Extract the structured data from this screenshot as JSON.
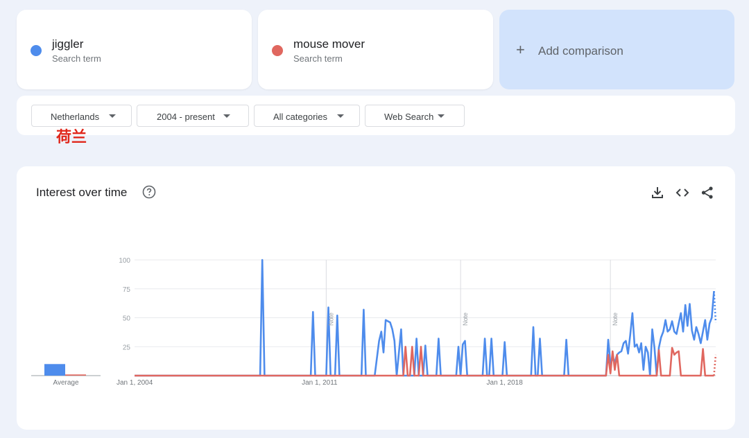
{
  "terms": [
    {
      "name": "jiggler",
      "subtitle": "Search term",
      "color": "#4e8cec"
    },
    {
      "name": "mouse mover",
      "subtitle": "Search term",
      "color": "#e0675f"
    }
  ],
  "add_comparison": {
    "icon": "plus-icon",
    "label": "Add comparison"
  },
  "filters": [
    {
      "label": "Netherlands"
    },
    {
      "label": "2004 - present"
    },
    {
      "label": "All categories"
    },
    {
      "label": "Web Search"
    }
  ],
  "annotation": "荷兰",
  "chart": {
    "title": "Interest over time",
    "icons": [
      "help-icon",
      "download-icon",
      "embed-code-icon",
      "share-icon"
    ]
  },
  "chart_data": {
    "type": "line",
    "ylim": [
      0,
      100
    ],
    "yticks": [
      100,
      75,
      50,
      25
    ],
    "xticks": [
      "Jan 1, 2004",
      "Jan 1, 2011",
      "Jan 1, 2018"
    ],
    "notes": [
      {
        "label": "Note",
        "x": "2011-04"
      },
      {
        "label": "Note",
        "x": "2016-05"
      },
      {
        "label": "Note",
        "x": "2022-01"
      }
    ],
    "average": {
      "label": "Average",
      "values": [
        {
          "name": "jiggler",
          "value": 10
        },
        {
          "name": "mouse mover",
          "value": 1
        }
      ]
    },
    "series": [
      {
        "name": "jiggler",
        "color": "#4e8cec",
        "points": [
          [
            "2004-01",
            0
          ],
          [
            "2008-10",
            0
          ],
          [
            "2008-11",
            100
          ],
          [
            "2008-12",
            0
          ],
          [
            "2010-09",
            0
          ],
          [
            "2010-10",
            55
          ],
          [
            "2010-11",
            0
          ],
          [
            "2011-04",
            0
          ],
          [
            "2011-05",
            59
          ],
          [
            "2011-06",
            0
          ],
          [
            "2011-08",
            0
          ],
          [
            "2011-09",
            52
          ],
          [
            "2011-10",
            0
          ],
          [
            "2012-08",
            0
          ],
          [
            "2012-09",
            57
          ],
          [
            "2012-10",
            0
          ],
          [
            "2013-02",
            0
          ],
          [
            "2013-04",
            30
          ],
          [
            "2013-05",
            38
          ],
          [
            "2013-06",
            20
          ],
          [
            "2013-07",
            48
          ],
          [
            "2013-09",
            46
          ],
          [
            "2013-10",
            40
          ],
          [
            "2013-11",
            30
          ],
          [
            "2013-12",
            0
          ],
          [
            "2014-02",
            40
          ],
          [
            "2014-03",
            0
          ],
          [
            "2014-08",
            0
          ],
          [
            "2014-09",
            32
          ],
          [
            "2014-10",
            0
          ],
          [
            "2014-12",
            0
          ],
          [
            "2015-01",
            26
          ],
          [
            "2015-02",
            0
          ],
          [
            "2015-06",
            0
          ],
          [
            "2015-07",
            32
          ],
          [
            "2015-08",
            0
          ],
          [
            "2016-03",
            0
          ],
          [
            "2016-04",
            25
          ],
          [
            "2016-05",
            0
          ],
          [
            "2016-06",
            27
          ],
          [
            "2016-07",
            30
          ],
          [
            "2016-08",
            0
          ],
          [
            "2017-03",
            0
          ],
          [
            "2017-04",
            32
          ],
          [
            "2017-05",
            0
          ],
          [
            "2017-06",
            0
          ],
          [
            "2017-07",
            32
          ],
          [
            "2017-08",
            0
          ],
          [
            "2017-12",
            0
          ],
          [
            "2018-01",
            29
          ],
          [
            "2018-02",
            0
          ],
          [
            "2019-01",
            0
          ],
          [
            "2019-02",
            42
          ],
          [
            "2019-03",
            0
          ],
          [
            "2019-04",
            0
          ],
          [
            "2019-05",
            32
          ],
          [
            "2019-06",
            0
          ],
          [
            "2020-04",
            0
          ],
          [
            "2020-05",
            31
          ],
          [
            "2020-06",
            0
          ],
          [
            "2021-11",
            0
          ],
          [
            "2021-12",
            31
          ],
          [
            "2022-01",
            10
          ],
          [
            "2022-02",
            15
          ],
          [
            "2022-03",
            12
          ],
          [
            "2022-04",
            18
          ],
          [
            "2022-05",
            20
          ],
          [
            "2022-06",
            21
          ],
          [
            "2022-07",
            28
          ],
          [
            "2022-08",
            30
          ],
          [
            "2022-09",
            19
          ],
          [
            "2022-10",
            35
          ],
          [
            "2022-11",
            54
          ],
          [
            "2022-12",
            25
          ],
          [
            "2023-01",
            27
          ],
          [
            "2023-02",
            20
          ],
          [
            "2023-03",
            28
          ],
          [
            "2023-04",
            5
          ],
          [
            "2023-05",
            25
          ],
          [
            "2023-06",
            20
          ],
          [
            "2023-07",
            0
          ],
          [
            "2023-08",
            40
          ],
          [
            "2023-09",
            24
          ],
          [
            "2023-10",
            0
          ],
          [
            "2023-11",
            24
          ],
          [
            "2023-12",
            33
          ],
          [
            "2024-01",
            38
          ],
          [
            "2024-02",
            48
          ],
          [
            "2024-03",
            38
          ],
          [
            "2024-04",
            40
          ],
          [
            "2024-05",
            47
          ],
          [
            "2024-06",
            38
          ],
          [
            "2024-07",
            36
          ],
          [
            "2024-08",
            45
          ],
          [
            "2024-09",
            54
          ],
          [
            "2024-10",
            38
          ],
          [
            "2024-11",
            61
          ],
          [
            "2024-12",
            43
          ],
          [
            "2025-01",
            62
          ],
          [
            "2025-02",
            39
          ],
          [
            "2025-03",
            31
          ],
          [
            "2025-04",
            42
          ],
          [
            "2025-05",
            36
          ],
          [
            "2025-06",
            28
          ],
          [
            "2025-07",
            38
          ],
          [
            "2025-08",
            48
          ],
          [
            "2025-09",
            31
          ],
          [
            "2025-10",
            45
          ],
          [
            "2025-11",
            50
          ],
          [
            "2025-12",
            73
          ]
        ],
        "partial": [
          [
            "2025-12",
            73
          ],
          [
            "2026-01",
            46
          ]
        ]
      },
      {
        "name": "mouse mover",
        "color": "#e0675f",
        "points": [
          [
            "2004-01",
            0
          ],
          [
            "2014-03",
            0
          ],
          [
            "2014-04",
            25
          ],
          [
            "2014-05",
            0
          ],
          [
            "2014-06",
            0
          ],
          [
            "2014-07",
            25
          ],
          [
            "2014-08",
            0
          ],
          [
            "2014-10",
            0
          ],
          [
            "2014-11",
            25
          ],
          [
            "2014-12",
            0
          ],
          [
            "2021-11",
            0
          ],
          [
            "2021-12",
            18
          ],
          [
            "2022-01",
            2
          ],
          [
            "2022-02",
            21
          ],
          [
            "2022-03",
            5
          ],
          [
            "2022-04",
            18
          ],
          [
            "2022-05",
            0
          ],
          [
            "2023-10",
            0
          ],
          [
            "2023-11",
            22
          ],
          [
            "2023-12",
            0
          ],
          [
            "2024-04",
            0
          ],
          [
            "2024-05",
            24
          ],
          [
            "2024-06",
            18
          ],
          [
            "2024-07",
            20
          ],
          [
            "2024-08",
            21
          ],
          [
            "2024-09",
            0
          ],
          [
            "2025-06",
            0
          ],
          [
            "2025-07",
            23
          ],
          [
            "2025-08",
            0
          ],
          [
            "2025-12",
            0
          ]
        ],
        "partial": [
          [
            "2025-12",
            0
          ],
          [
            "2026-01",
            18
          ]
        ]
      }
    ]
  }
}
